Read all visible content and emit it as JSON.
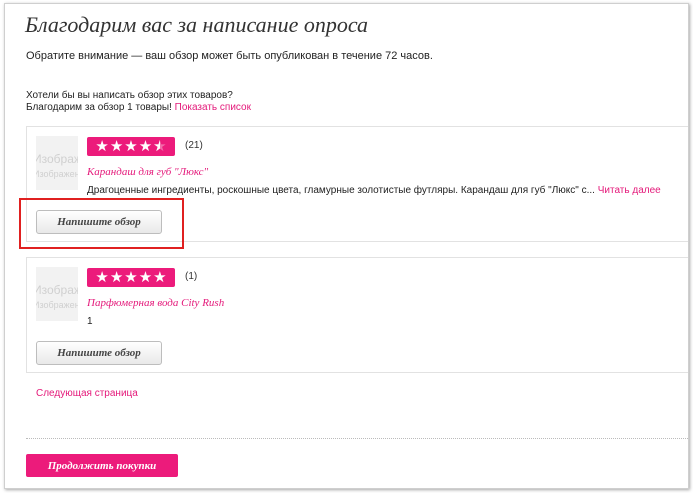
{
  "page": {
    "title": "Благодарим вас за написание опроса",
    "note": "Обратите внимание — ваш обзор может быть опубликован в течение 72 часов.",
    "ask": "Хотели бы вы написать обзор этих товаров?",
    "thanks_text": "Благодарим за обзор 1 товары!",
    "show_list_link": "Показать список"
  },
  "products": [
    {
      "image_placeholder": "Изображение",
      "rating": 4.5,
      "review_count": "(21)",
      "name": "Карандаш для губ \"Люкс\"",
      "description": "Драгоценные ингредиенты, роскошные цвета, гламурные золотистые футляры. Карандаш для губ \"Люкс\" с...",
      "read_more": "Читать далее",
      "review_button": "Напишите обзор"
    },
    {
      "image_placeholder": "Изображение",
      "rating": 5,
      "review_count": "(1)",
      "name": "Парфюмерная вода City Rush",
      "description": "1",
      "review_button": "Напишите обзор"
    }
  ],
  "pagination": {
    "next_page": "Следующая страница"
  },
  "footer": {
    "continue_button": "Продолжить покупки"
  },
  "colors": {
    "accent": "#ec1b7b",
    "link": "#e4197a",
    "highlight": "#e02020"
  }
}
